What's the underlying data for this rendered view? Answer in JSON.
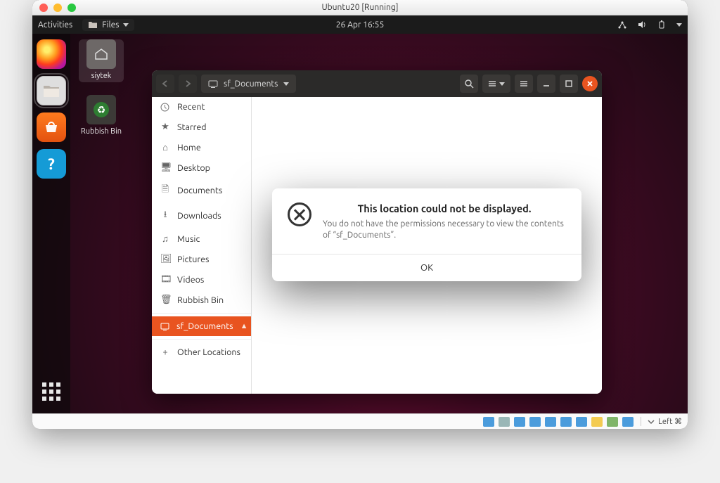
{
  "host_window": {
    "title": "Ubuntu20 [Running]"
  },
  "topbar": {
    "activities": "Activities",
    "app_menu": "Files",
    "clock": "26 Apr  16:55"
  },
  "desktop_icons": {
    "home": "siytek",
    "trash": "Rubbish Bin"
  },
  "nautilus": {
    "path_label": "sf_Documents",
    "sidebar": [
      {
        "icon": "clock",
        "label": "Recent"
      },
      {
        "icon": "star",
        "label": "Starred"
      },
      {
        "icon": "home",
        "label": "Home"
      },
      {
        "icon": "desktop",
        "label": "Desktop"
      },
      {
        "icon": "docs",
        "label": "Documents"
      },
      {
        "icon": "download",
        "label": "Downloads"
      },
      {
        "icon": "music",
        "label": "Music"
      },
      {
        "icon": "picture",
        "label": "Pictures"
      },
      {
        "icon": "video",
        "label": "Videos"
      },
      {
        "icon": "trash",
        "label": "Rubbish Bin"
      },
      {
        "icon": "drive",
        "label": "sf_Documents",
        "active": true,
        "ejectable": true
      },
      {
        "icon": "plus",
        "label": "Other Locations"
      }
    ]
  },
  "dialog": {
    "title": "This location could not be displayed.",
    "message": "You do not have the permissions necessary to view the contents of “sf_Documents”.",
    "ok": "OK"
  },
  "vb_status": {
    "host_key": "Left ⌘"
  }
}
